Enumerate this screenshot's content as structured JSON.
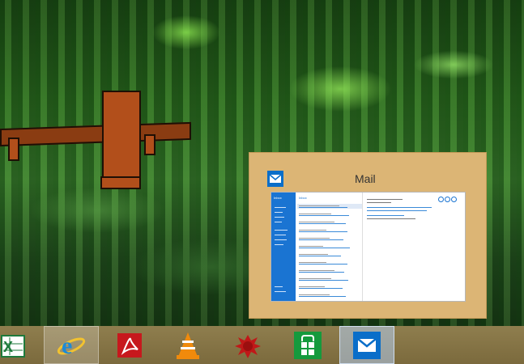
{
  "preview": {
    "title": "Mail",
    "thumbnail": {
      "sidebar_label": "Inbox",
      "list_header": "Inbox"
    }
  },
  "taskbar": {
    "items": [
      {
        "name": "Excel",
        "icon": "excel-icon"
      },
      {
        "name": "Internet Explorer",
        "icon": "ie-icon"
      },
      {
        "name": "Adobe Reader",
        "icon": "pdf-icon"
      },
      {
        "name": "VLC media player",
        "icon": "vlc-icon"
      },
      {
        "name": "Paint tool",
        "icon": "paint-splat-icon"
      },
      {
        "name": "Store",
        "icon": "store-icon"
      },
      {
        "name": "Mail",
        "icon": "mail-icon"
      }
    ]
  },
  "colors": {
    "preview_bg": "#dcb575",
    "taskbar_bg": "#8a784a",
    "mail_blue": "#0a6ec9",
    "store_green": "#159a3d",
    "pdf_red": "#c7181d"
  }
}
